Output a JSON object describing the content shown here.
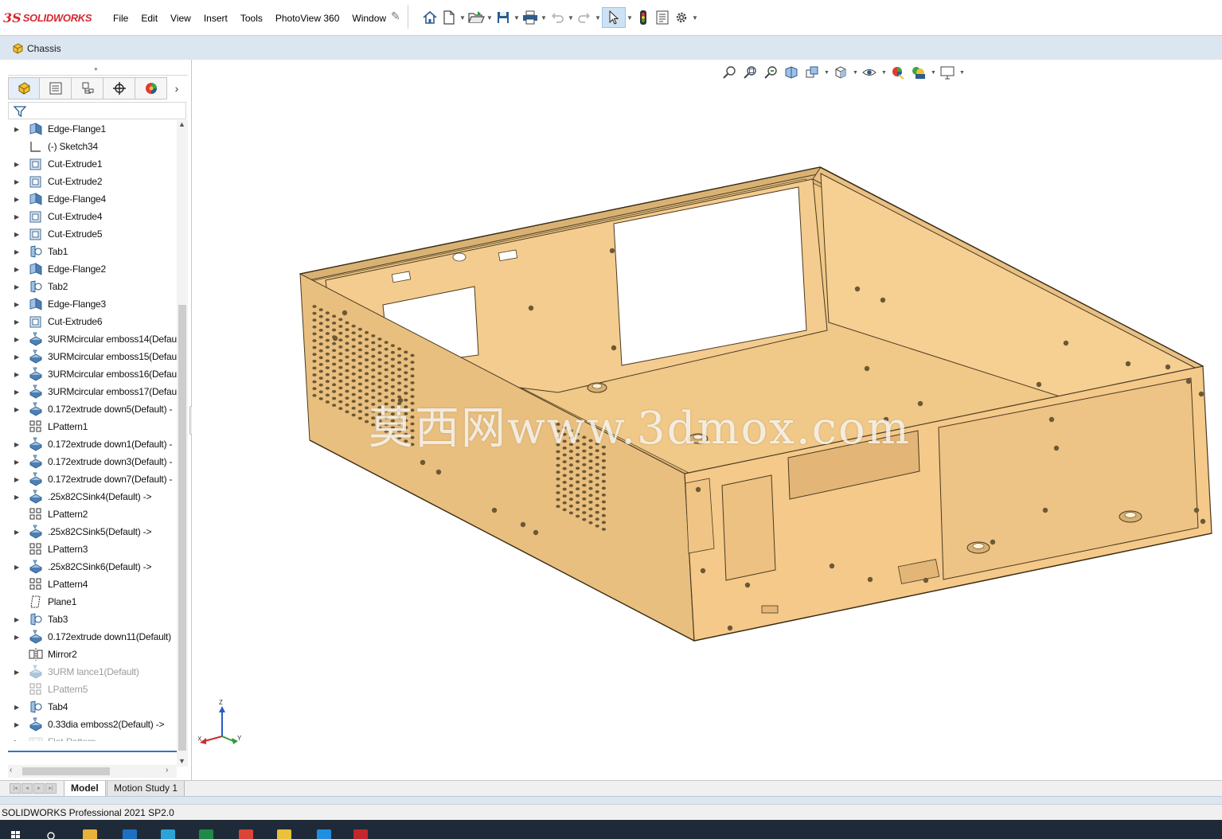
{
  "app": {
    "brand_prefix": "3S",
    "brand_name": "SOLIDWORKS",
    "menu": [
      "File",
      "Edit",
      "View",
      "Insert",
      "Tools",
      "PhotoView 360",
      "Window"
    ]
  },
  "document": {
    "title": "Chassis"
  },
  "feature_tree": {
    "items": [
      {
        "label": "Edge-Flange1",
        "icon": "edge-flange-icon",
        "expandable": true,
        "suppressed": false
      },
      {
        "label": "(-) Sketch34",
        "icon": "sketch-icon",
        "expandable": false,
        "suppressed": false
      },
      {
        "label": "Cut-Extrude1",
        "icon": "cut-extrude-icon",
        "expandable": true,
        "suppressed": false
      },
      {
        "label": "Cut-Extrude2",
        "icon": "cut-extrude-icon",
        "expandable": true,
        "suppressed": false
      },
      {
        "label": "Edge-Flange4",
        "icon": "edge-flange-icon",
        "expandable": true,
        "suppressed": false
      },
      {
        "label": "Cut-Extrude4",
        "icon": "cut-extrude-icon",
        "expandable": true,
        "suppressed": false
      },
      {
        "label": "Cut-Extrude5",
        "icon": "cut-extrude-icon",
        "expandable": true,
        "suppressed": false
      },
      {
        "label": "Tab1",
        "icon": "tab-icon",
        "expandable": true,
        "suppressed": false
      },
      {
        "label": "Edge-Flange2",
        "icon": "edge-flange-icon",
        "expandable": true,
        "suppressed": false
      },
      {
        "label": "Tab2",
        "icon": "tab-icon",
        "expandable": true,
        "suppressed": false
      },
      {
        "label": "Edge-Flange3",
        "icon": "edge-flange-icon",
        "expandable": true,
        "suppressed": false
      },
      {
        "label": "Cut-Extrude6",
        "icon": "cut-extrude-icon",
        "expandable": true,
        "suppressed": false
      },
      {
        "label": "3URMcircular emboss14(Defau",
        "icon": "forming-tool-icon",
        "expandable": true,
        "suppressed": false
      },
      {
        "label": "3URMcircular emboss15(Defau",
        "icon": "forming-tool-icon",
        "expandable": true,
        "suppressed": false
      },
      {
        "label": "3URMcircular emboss16(Defau",
        "icon": "forming-tool-icon",
        "expandable": true,
        "suppressed": false
      },
      {
        "label": "3URMcircular emboss17(Defau",
        "icon": "forming-tool-icon",
        "expandable": true,
        "suppressed": false
      },
      {
        "label": "0.172extrude down5(Default) -",
        "icon": "forming-tool-icon",
        "expandable": true,
        "suppressed": false
      },
      {
        "label": "LPattern1",
        "icon": "linear-pattern-icon",
        "expandable": false,
        "suppressed": false
      },
      {
        "label": "0.172extrude down1(Default) -",
        "icon": "forming-tool-icon",
        "expandable": true,
        "suppressed": false
      },
      {
        "label": "0.172extrude down3(Default) -",
        "icon": "forming-tool-icon",
        "expandable": true,
        "suppressed": false
      },
      {
        "label": "0.172extrude down7(Default) -",
        "icon": "forming-tool-icon",
        "expandable": true,
        "suppressed": false
      },
      {
        "label": ".25x82CSink4(Default) ->",
        "icon": "forming-tool-icon",
        "expandable": true,
        "suppressed": false
      },
      {
        "label": "LPattern2",
        "icon": "linear-pattern-icon",
        "expandable": false,
        "suppressed": false
      },
      {
        "label": ".25x82CSink5(Default) ->",
        "icon": "forming-tool-icon",
        "expandable": true,
        "suppressed": false
      },
      {
        "label": "LPattern3",
        "icon": "linear-pattern-icon",
        "expandable": false,
        "suppressed": false
      },
      {
        "label": ".25x82CSink6(Default) ->",
        "icon": "forming-tool-icon",
        "expandable": true,
        "suppressed": false
      },
      {
        "label": "LPattern4",
        "icon": "linear-pattern-icon",
        "expandable": false,
        "suppressed": false
      },
      {
        "label": "Plane1",
        "icon": "plane-icon",
        "expandable": false,
        "suppressed": false
      },
      {
        "label": "Tab3",
        "icon": "tab-icon",
        "expandable": true,
        "suppressed": false
      },
      {
        "label": "0.172extrude down11(Default)",
        "icon": "forming-tool-icon",
        "expandable": true,
        "suppressed": false
      },
      {
        "label": "Mirror2",
        "icon": "mirror-icon",
        "expandable": false,
        "suppressed": false
      },
      {
        "label": "3URM lance1(Default)",
        "icon": "forming-tool-icon",
        "expandable": true,
        "suppressed": true
      },
      {
        "label": "LPattern5",
        "icon": "linear-pattern-icon",
        "expandable": false,
        "suppressed": true
      },
      {
        "label": "Tab4",
        "icon": "tab-icon",
        "expandable": true,
        "suppressed": false
      },
      {
        "label": "0.33dia emboss2(Default) ->",
        "icon": "forming-tool-icon",
        "expandable": true,
        "suppressed": false
      },
      {
        "label": "Flat-Pattern",
        "icon": "flat-pattern-icon",
        "expandable": true,
        "suppressed": true
      }
    ]
  },
  "bottom_tabs": {
    "model": "Model",
    "motion_study": "Motion Study 1"
  },
  "viewport": {
    "watermark": "莫西网www.3dmox.com",
    "triad": {
      "x": "X",
      "y": "Y",
      "z": "Z"
    },
    "part_color": "#f3c98c"
  },
  "status": {
    "version": "SOLIDWORKS Professional 2021 SP2.0"
  }
}
